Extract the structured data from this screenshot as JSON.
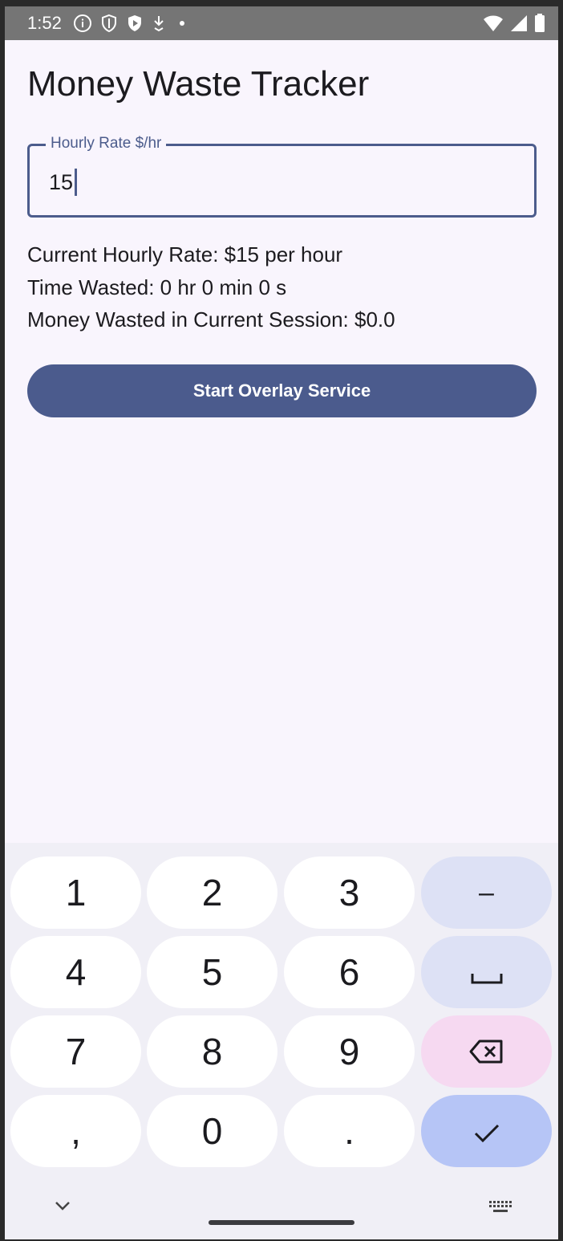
{
  "status_bar": {
    "time": "1:52",
    "icons_left": [
      "info-icon",
      "shield-icon",
      "shield-play-icon",
      "download-icon",
      "dot-icon"
    ],
    "icons_right": [
      "wifi-icon",
      "signal-icon",
      "battery-icon"
    ]
  },
  "app": {
    "title": "Money Waste Tracker",
    "rate_field": {
      "label": "Hourly Rate $/hr",
      "value": "15"
    },
    "info": {
      "current_rate": "Current Hourly Rate: $15 per hour",
      "time_wasted": "Time Wasted: 0 hr 0 min 0 s",
      "money_wasted": "Money Wasted in Current Session: $0.0"
    },
    "start_button_label": "Start Overlay Service"
  },
  "keyboard": {
    "rows": [
      [
        "1",
        "2",
        "3",
        "–"
      ],
      [
        "4",
        "5",
        "6",
        "space"
      ],
      [
        "7",
        "8",
        "9",
        "backspace"
      ],
      [
        ",",
        "0",
        ".",
        "enter"
      ]
    ],
    "keys": {
      "k1": "1",
      "k2": "2",
      "k3": "3",
      "dash": "–",
      "k4": "4",
      "k5": "5",
      "k6": "6",
      "k7": "7",
      "k8": "8",
      "k9": "9",
      "comma": ",",
      "k0": "0",
      "period": "."
    },
    "bottom_left_icon": "chevron-down-icon",
    "bottom_right_icon": "keyboard-icon"
  },
  "colors": {
    "accent": "#4b5b8d",
    "background": "#f9f5fd",
    "status_bar": "#757575",
    "key_func": "#dde1f5",
    "key_delete": "#f6d9f1",
    "key_enter": "#b6c5f6"
  }
}
